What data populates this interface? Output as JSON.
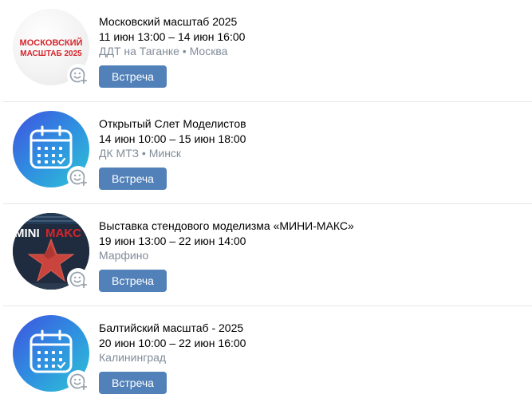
{
  "events": [
    {
      "title": "Московский масштаб 2025",
      "date": "11 июн 13:00 – 14 июн 16:00",
      "location": "ДДТ на Таганке • Москва",
      "button": "Встреча",
      "logo_line1": "МОСКОВСКИЙ",
      "logo_line2": "МАСШТАБ 2025",
      "avatar": "moscow-scale-logo"
    },
    {
      "title": "Открытый Слет Моделистов",
      "date": "14 июн 10:00 – 15 июн 18:00",
      "location": "ДК МТЗ • Минск",
      "button": "Встреча",
      "avatar": "calendar-icon"
    },
    {
      "title": "Выставка стендового моделизма «МИНИ-МАКС»",
      "date": "19 июн 13:00 – 22 июн 14:00",
      "location": "Марфино",
      "button": "Встреча",
      "avatar": "mini-maks-poster"
    },
    {
      "title": "Балтийский масштаб - 2025",
      "date": "20 июн 10:00 – 22 июн 16:00",
      "location": "Калининград",
      "button": "Встреча",
      "avatar": "calendar-icon"
    }
  ],
  "icons": {
    "reaction": "add-reaction-icon"
  },
  "colors": {
    "button_bg": "#5181b8",
    "secondary_text": "#818c99",
    "divider": "#e3e6ea",
    "calendar_gradient_start": "#3f51e0",
    "calendar_gradient_end": "#2fc3d6",
    "logo_red": "#d6252b"
  }
}
